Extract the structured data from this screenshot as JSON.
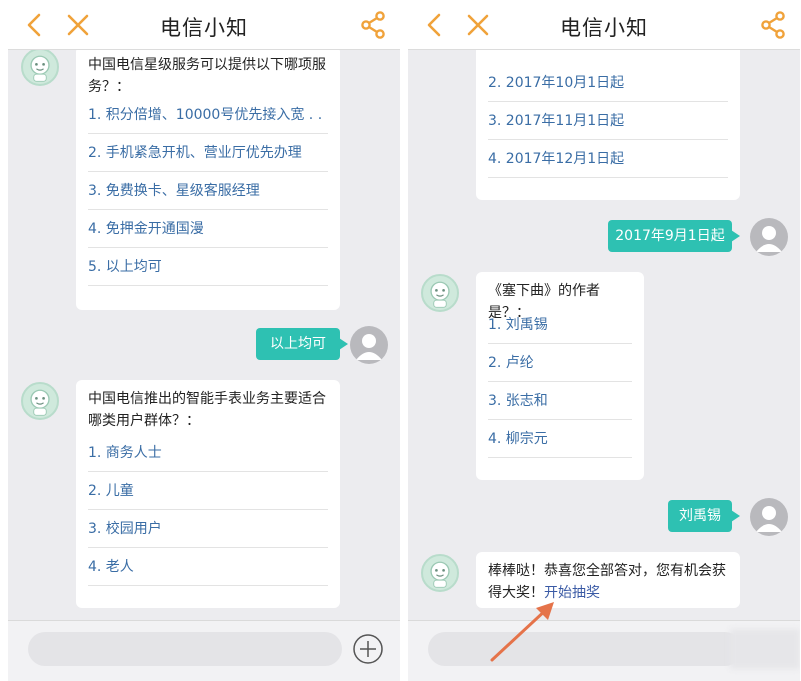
{
  "app": {
    "title": "电信小知"
  },
  "left": {
    "q1": {
      "question": "中国电信星级服务可以提供以下哪项服务？：",
      "options": [
        "1. 积分倍增、10000号优先接入宽 . . .",
        "2. 手机紧急开机、营业厅优先办理",
        "3. 免费换卡、星级客服经理",
        "4. 免押金开通国漫",
        "5. 以上均可"
      ]
    },
    "reply1": "以上均可",
    "q2": {
      "question": "中国电信推出的智能手表业务主要适合哪类用户群体？：",
      "options": [
        "1. 商务人士",
        "2. 儿童",
        "3. 校园用户",
        "4. 老人"
      ]
    }
  },
  "right": {
    "prev": {
      "options": [
        "2. 2017年10月1日起",
        "3. 2017年11月1日起",
        "4. 2017年12月1日起"
      ]
    },
    "reply1": "2017年9月1日起",
    "q2": {
      "question": "《塞下曲》的作者是？：",
      "options": [
        "1. 刘禹锡",
        "2. 卢纶",
        "3. 张志和",
        "4. 柳宗元"
      ]
    },
    "reply2": "刘禹锡",
    "prize": {
      "text": "棒棒哒！恭喜您全部答对，您有机会获得大奖！",
      "link": "开始抽奖"
    }
  },
  "colors": {
    "accent": "#f0a23a",
    "reply_bubble": "#2ec1b2",
    "option_text": "#3a6da5",
    "arrow": "#e5734a"
  }
}
